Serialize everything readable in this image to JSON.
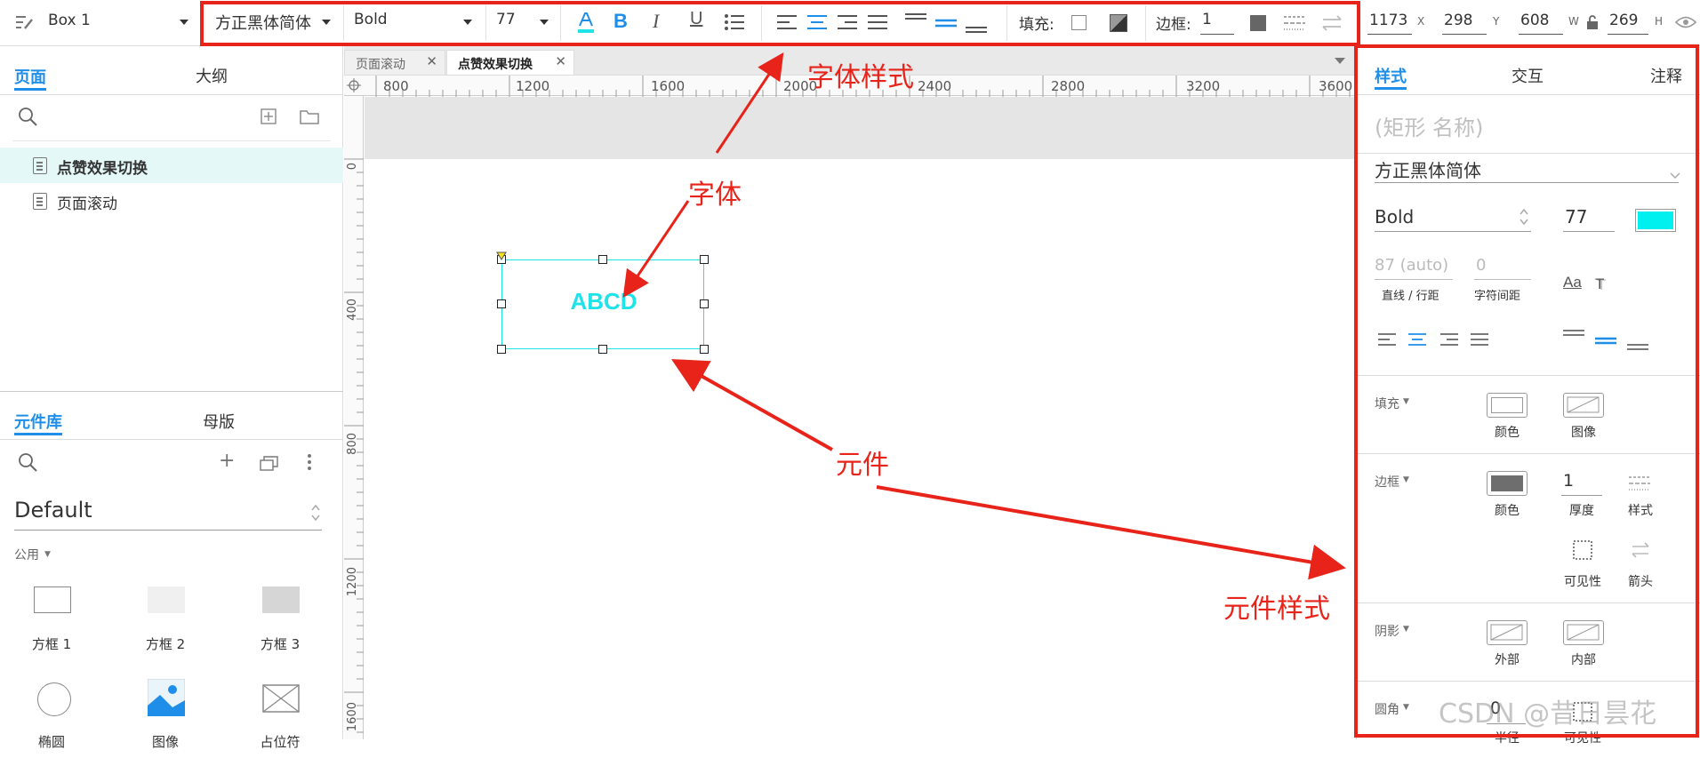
{
  "toolbar": {
    "shape_name": "Box 1",
    "font_family": "方正黑体简体",
    "font_weight": "Bold",
    "font_size": "77",
    "fill_label": "填充:",
    "border_label": "边框:",
    "border_value": "1",
    "x_value": "1173",
    "x_label": "X",
    "y_value": "298",
    "y_label": "Y",
    "w_value": "608",
    "w_label": "W",
    "h_value": "269",
    "h_label": "H"
  },
  "left_panel": {
    "tabs": [
      "页面",
      "大纲"
    ],
    "pages": [
      "点赞效果切换",
      "页面滚动"
    ],
    "lib_tabs": [
      "元件库",
      "母版"
    ],
    "library_name": "Default",
    "category": "公用",
    "widgets": [
      "方框 1",
      "方框 2",
      "方框 3",
      "椭圆",
      "图像",
      "占位符"
    ]
  },
  "canvas": {
    "doc_tabs": [
      "页面滚动",
      "点赞效果切换"
    ],
    "ruler_h": [
      "800",
      "1200",
      "1600",
      "2000",
      "2400",
      "2800",
      "3200",
      "3600"
    ],
    "ruler_v": [
      "0",
      "400",
      "800",
      "1200",
      "1600"
    ],
    "shape_text": "ABCD",
    "accent": "#1ee3e8"
  },
  "right_panel": {
    "tabs": [
      "样式",
      "交互",
      "注释"
    ],
    "shape_name_placeholder": "(矩形 名称)",
    "font_family": "方正黑体简体",
    "font_weight": "Bold",
    "font_size": "77",
    "font_color": "#00f0f0",
    "line_spacing": "87 (auto)",
    "line_spacing_label": "直线 / 行距",
    "char_spacing": "0",
    "char_spacing_label": "字符间距",
    "fill_section": "填充",
    "fill_color_label": "颜色",
    "fill_image_label": "图像",
    "border_section": "边框",
    "border_color_label": "颜色",
    "border_thickness": "1",
    "border_thickness_label": "厚度",
    "border_style_label": "样式",
    "visibility_label": "可见性",
    "arrow_label": "箭头",
    "shadow_section": "阴影",
    "shadow_outer_label": "外部",
    "shadow_inner_label": "内部",
    "radius_section": "圆角",
    "radius_value": "0",
    "radius_label": "半径",
    "visible_label": "可见性"
  },
  "annotations": {
    "font_style": "字体样式",
    "font": "字体",
    "widget": "元件",
    "widget_style": "元件样式",
    "watermark": "CSDN @昔日昙花"
  },
  "colors": {
    "annotation_red": "#e8231a",
    "accent_blue": "#1f8ee8",
    "cyan": "#1ee3e8"
  }
}
